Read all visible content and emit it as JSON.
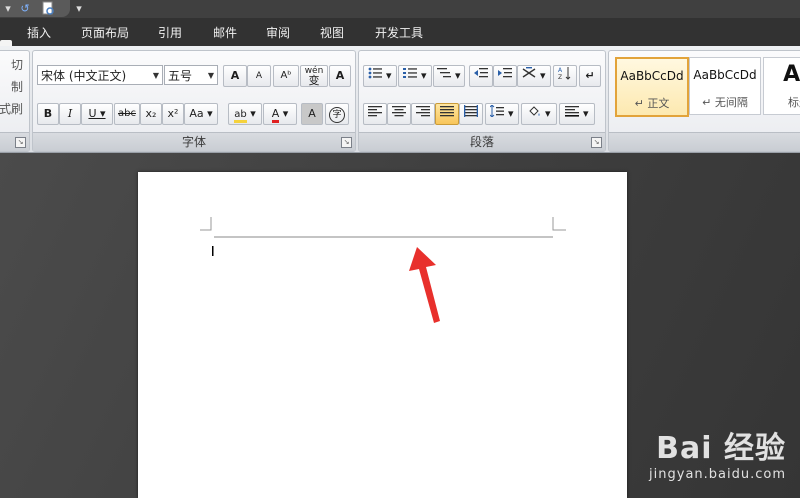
{
  "tabs": [
    "插入",
    "页面布局",
    "引用",
    "邮件",
    "审阅",
    "视图",
    "开发工具"
  ],
  "clipboard": {
    "cut_fragment": "切",
    "copy_fragment": "制",
    "format_fragment": "式刷"
  },
  "font": {
    "name": "宋体 (中文正文)",
    "size": "五号",
    "group_label": "字体",
    "buttons": {
      "grow": "A",
      "shrink": "A",
      "clear": "Aᵇ",
      "phonetic_top": "wén",
      "phonetic": "变",
      "border": "A",
      "bold": "B",
      "italic": "I",
      "underline": "U",
      "strike": "abc",
      "subscript": "x₂",
      "superscript": "x²",
      "change_case": "Aa",
      "highlight": "ab",
      "color": "A",
      "shading": "A",
      "enclose": "字"
    }
  },
  "paragraph": {
    "group_label": "段落"
  },
  "styles": [
    {
      "sample": "AaBbCcDd",
      "name": "↵ 正文"
    },
    {
      "sample": "AaBbCcDd",
      "name": "↵ 无间隔"
    },
    {
      "sample": "Aa",
      "name": "标题"
    }
  ],
  "watermark": {
    "logo": "Bai 经验",
    "url": "jingyan.baidu.com"
  },
  "colors": {
    "accent_highlight": "#f5d23c",
    "font_color": "#e02020",
    "arrow": "#e8302c",
    "active_style_border": "#e2a33a"
  }
}
